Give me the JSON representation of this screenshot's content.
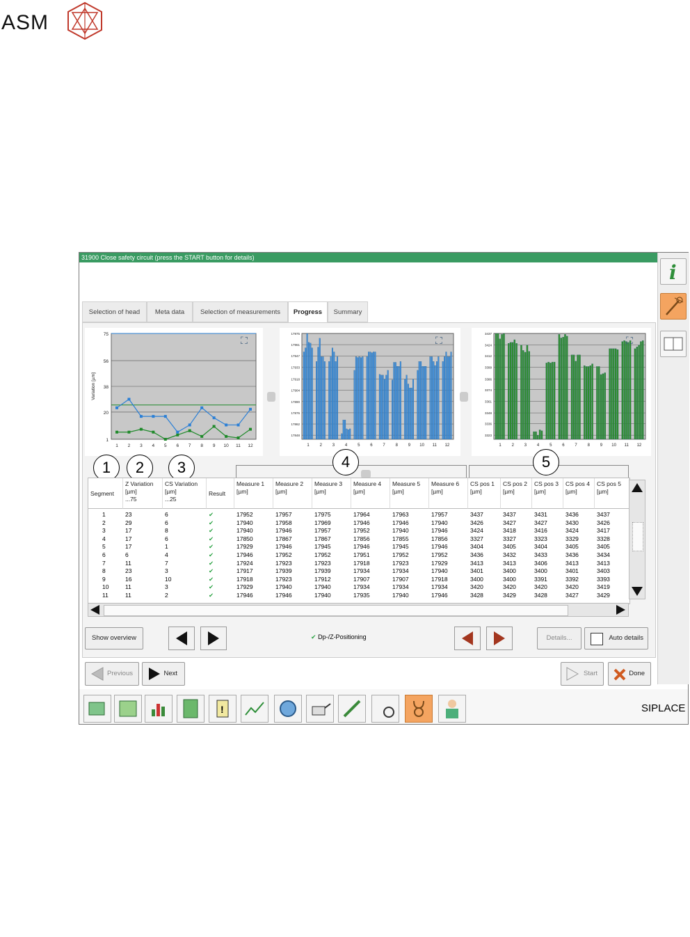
{
  "logo": {
    "text": "ASM"
  },
  "window": {
    "title": "31900 Close safety circuit (press the START button for details)"
  },
  "tabs": [
    {
      "label": "Selection of head"
    },
    {
      "label": "Meta data"
    },
    {
      "label": "Selection of measurements"
    },
    {
      "label": "Progress"
    },
    {
      "label": "Summary"
    }
  ],
  "charts": {
    "line": {
      "ylabel": "Variation [µm]",
      "yticks": [
        "75",
        "56",
        "38",
        "20",
        "1"
      ],
      "xticks": [
        "1",
        "2",
        "3",
        "4",
        "5",
        "6",
        "7",
        "8",
        "9",
        "10",
        "11",
        "12"
      ]
    },
    "measure": {
      "yticks": [
        "17975",
        "17961",
        "17947",
        "17933",
        "17918",
        "17904",
        "17890",
        "17876",
        "17862",
        "17848"
      ],
      "xticks": [
        "1",
        "2",
        "3",
        "4",
        "5",
        "6",
        "7",
        "8",
        "9",
        "10",
        "11",
        "12"
      ]
    },
    "cs": {
      "yticks": [
        "3437",
        "3424",
        "3412",
        "3399",
        "3386",
        "3374",
        "3361",
        "3348",
        "3336",
        "3323"
      ],
      "xticks": [
        "1",
        "2",
        "3",
        "4",
        "5",
        "6",
        "7",
        "8",
        "9",
        "10",
        "11",
        "12"
      ]
    }
  },
  "chart_data": [
    {
      "type": "line",
      "title": "",
      "xlabel": "",
      "ylabel": "Variation [µm]",
      "ylim": [
        1,
        75
      ],
      "x": [
        1,
        2,
        3,
        4,
        5,
        6,
        7,
        8,
        9,
        10,
        11,
        12
      ],
      "series": [
        {
          "name": "",
          "color": "#2a7fd6",
          "values": [
            23,
            29,
            17,
            17,
            17,
            6,
            11,
            23,
            16,
            11,
            11,
            22
          ]
        },
        {
          "name": "",
          "color": "#1f8a2a",
          "values": [
            6,
            6,
            8,
            6,
            1,
            4,
            7,
            3,
            10,
            3,
            2,
            8
          ]
        }
      ],
      "thresholds": [
        {
          "color": "#1f8a2a",
          "value": 25
        },
        {
          "color": "#2a7fd6",
          "value": 75
        }
      ]
    },
    {
      "type": "bar",
      "title": "",
      "xlabel": "",
      "ylabel": "",
      "ylim": [
        17848,
        17975
      ],
      "categories": [
        "1",
        "2",
        "3",
        "4",
        "5",
        "6",
        "7",
        "8",
        "9",
        "10",
        "11",
        "12"
      ],
      "series": [
        {
          "name": "",
          "color": "#3b8fe0",
          "values": [
            [
              17952,
              17957,
              17975,
              17964,
              17963,
              17957
            ],
            [
              17940,
              17958,
              17969,
              17946,
              17946,
              17940
            ],
            [
              17940,
              17946,
              17957,
              17952,
              17940,
              17946
            ],
            [
              17850,
              17867,
              17867,
              17856,
              17855,
              17856
            ],
            [
              17929,
              17946,
              17945,
              17946,
              17945,
              17946
            ],
            [
              17946,
              17952,
              17952,
              17951,
              17952,
              17952
            ],
            [
              17924,
              17923,
              17923,
              17918,
              17923,
              17929
            ],
            [
              17917,
              17939,
              17939,
              17934,
              17934,
              17940
            ],
            [
              17918,
              17923,
              17912,
              17907,
              17907,
              17918
            ],
            [
              17929,
              17940,
              17940,
              17934,
              17934,
              17934
            ],
            [
              17946,
              17946,
              17940,
              17935,
              17940,
              17946
            ],
            [
              17940,
              17946,
              17952,
              17946,
              17946,
              17952
            ]
          ]
        }
      ]
    },
    {
      "type": "bar",
      "title": "",
      "xlabel": "",
      "ylabel": "",
      "ylim": [
        3323,
        3437
      ],
      "categories": [
        "1",
        "2",
        "3",
        "4",
        "5",
        "6",
        "7",
        "8",
        "9",
        "10",
        "11",
        "12"
      ],
      "series": [
        {
          "name": "",
          "color": "#2e8f2e",
          "values": [
            [
              3437,
              3437,
              3431,
              3436,
              3437
            ],
            [
              3426,
              3427,
              3427,
              3430,
              3426
            ],
            [
              3424,
              3418,
              3416,
              3424,
              3417
            ],
            [
              3327,
              3327,
              3323,
              3329,
              3328
            ],
            [
              3404,
              3405,
              3404,
              3405,
              3405
            ],
            [
              3436,
              3432,
              3433,
              3436,
              3434
            ],
            [
              3413,
              3413,
              3406,
              3413,
              3413
            ],
            [
              3401,
              3400,
              3400,
              3401,
              3403
            ],
            [
              3400,
              3400,
              3391,
              3392,
              3393
            ],
            [
              3420,
              3420,
              3420,
              3420,
              3419
            ],
            [
              3428,
              3429,
              3428,
              3427,
              3429
            ],
            [
              3420,
              3422,
              3424,
              3428,
              3429
            ]
          ]
        }
      ]
    }
  ],
  "callouts": [
    "1",
    "2",
    "3",
    "4",
    "5"
  ],
  "table": {
    "headers": [
      {
        "l1": "Segment",
        "l2": "",
        "l3": ""
      },
      {
        "l1": "Z Variation",
        "l2": "[µm]",
        "l3": "...75"
      },
      {
        "l1": "CS Variation",
        "l2": "[µm]",
        "l3": "...25"
      },
      {
        "l1": "Result",
        "l2": "",
        "l3": ""
      },
      {
        "l1": "Measure 1",
        "l2": "[µm]",
        "l3": ""
      },
      {
        "l1": "Measure 2",
        "l2": "[µm]",
        "l3": ""
      },
      {
        "l1": "Measure 3",
        "l2": "[µm]",
        "l3": ""
      },
      {
        "l1": "Measure 4",
        "l2": "[µm]",
        "l3": ""
      },
      {
        "l1": "Measure 5",
        "l2": "[µm]",
        "l3": ""
      },
      {
        "l1": "Measure 6",
        "l2": "[µm]",
        "l3": ""
      },
      {
        "l1": "CS pos 1",
        "l2": "[µm]",
        "l3": ""
      },
      {
        "l1": "CS pos 2",
        "l2": "[µm]",
        "l3": ""
      },
      {
        "l1": "CS pos 3",
        "l2": "[µm]",
        "l3": ""
      },
      {
        "l1": "CS pos 4",
        "l2": "[µm]",
        "l3": ""
      },
      {
        "l1": "CS pos 5",
        "l2": "[µm]",
        "l3": ""
      }
    ],
    "rows": [
      [
        "1",
        "23",
        "6",
        "17952",
        "17957",
        "17975",
        "17964",
        "17963",
        "17957",
        "3437",
        "3437",
        "3431",
        "3436",
        "3437"
      ],
      [
        "2",
        "29",
        "6",
        "17940",
        "17958",
        "17969",
        "17946",
        "17946",
        "17940",
        "3426",
        "3427",
        "3427",
        "3430",
        "3426"
      ],
      [
        "3",
        "17",
        "8",
        "17940",
        "17946",
        "17957",
        "17952",
        "17940",
        "17946",
        "3424",
        "3418",
        "3416",
        "3424",
        "3417"
      ],
      [
        "4",
        "17",
        "6",
        "17850",
        "17867",
        "17867",
        "17856",
        "17855",
        "17856",
        "3327",
        "3327",
        "3323",
        "3329",
        "3328"
      ],
      [
        "5",
        "17",
        "1",
        "17929",
        "17946",
        "17945",
        "17946",
        "17945",
        "17946",
        "3404",
        "3405",
        "3404",
        "3405",
        "3405"
      ],
      [
        "6",
        "6",
        "4",
        "17946",
        "17952",
        "17952",
        "17951",
        "17952",
        "17952",
        "3436",
        "3432",
        "3433",
        "3436",
        "3434"
      ],
      [
        "7",
        "11",
        "7",
        "17924",
        "17923",
        "17923",
        "17918",
        "17923",
        "17929",
        "3413",
        "3413",
        "3406",
        "3413",
        "3413"
      ],
      [
        "8",
        "23",
        "3",
        "17917",
        "17939",
        "17939",
        "17934",
        "17934",
        "17940",
        "3401",
        "3400",
        "3400",
        "3401",
        "3403"
      ],
      [
        "9",
        "16",
        "10",
        "17918",
        "17923",
        "17912",
        "17907",
        "17907",
        "17918",
        "3400",
        "3400",
        "3391",
        "3392",
        "3393"
      ],
      [
        "10",
        "11",
        "3",
        "17929",
        "17940",
        "17940",
        "17934",
        "17934",
        "17934",
        "3420",
        "3420",
        "3420",
        "3420",
        "3419"
      ],
      [
        "11",
        "11",
        "2",
        "17946",
        "17946",
        "17940",
        "17935",
        "17940",
        "17946",
        "3428",
        "3429",
        "3428",
        "3427",
        "3429"
      ]
    ]
  },
  "controls": {
    "show_overview": "Show overview",
    "dp_positioning": "Dp-/Z-Positioning",
    "details": "Details...",
    "auto_details": "Auto details",
    "previous": "Previous",
    "next": "Next",
    "start": "Start",
    "done": "Done"
  },
  "brand": "SIPLACE",
  "colors": {
    "titlebar": "#3a9b62",
    "accent": "#f4a460",
    "check": "#2da345"
  }
}
